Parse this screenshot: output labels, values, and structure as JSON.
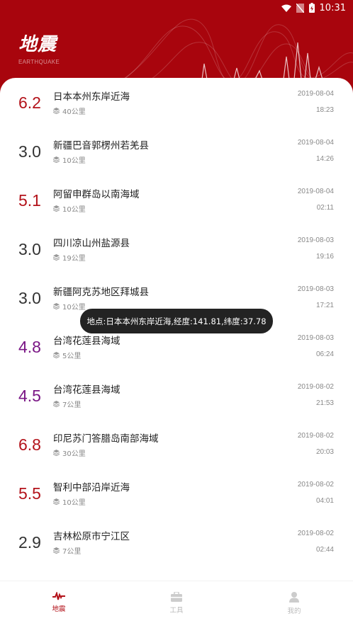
{
  "status_bar": {
    "time": "10:31"
  },
  "header": {
    "title": "地震",
    "subtitle": "EARTHQUAKE"
  },
  "colors": {
    "brand_red": "#a8050d",
    "mag_high": "#b3121a",
    "mag_mid": "#7a1685",
    "mag_low": "#333333"
  },
  "events": [
    {
      "magnitude": "6.2",
      "place": "日本本州东岸近海",
      "depth": "40公里",
      "date": "2019-08-04",
      "time": "18:23",
      "level": "high"
    },
    {
      "magnitude": "3.0",
      "place": "新疆巴音郭楞州若羌县",
      "depth": "10公里",
      "date": "2019-08-04",
      "time": "14:26",
      "level": "low"
    },
    {
      "magnitude": "5.1",
      "place": "阿留申群岛以南海域",
      "depth": "10公里",
      "date": "2019-08-04",
      "time": "02:11",
      "level": "high"
    },
    {
      "magnitude": "3.0",
      "place": "四川凉山州盐源县",
      "depth": "19公里",
      "date": "2019-08-03",
      "time": "19:16",
      "level": "low"
    },
    {
      "magnitude": "3.0",
      "place": "新疆阿克苏地区拜城县",
      "depth": "10公里",
      "date": "2019-08-03",
      "time": "17:21",
      "level": "low"
    },
    {
      "magnitude": "4.8",
      "place": "台湾花莲县海域",
      "depth": "5公里",
      "date": "2019-08-03",
      "time": "06:24",
      "level": "mid"
    },
    {
      "magnitude": "4.5",
      "place": "台湾花莲县海域",
      "depth": "7公里",
      "date": "2019-08-02",
      "time": "21:53",
      "level": "mid"
    },
    {
      "magnitude": "6.8",
      "place": "印尼苏门答腊岛南部海域",
      "depth": "30公里",
      "date": "2019-08-02",
      "time": "20:03",
      "level": "high"
    },
    {
      "magnitude": "5.5",
      "place": "智利中部沿岸近海",
      "depth": "10公里",
      "date": "2019-08-02",
      "time": "04:01",
      "level": "high"
    },
    {
      "magnitude": "2.9",
      "place": "吉林松原市宁江区",
      "depth": "7公里",
      "date": "2019-08-02",
      "time": "02:44",
      "level": "low"
    }
  ],
  "toast": "地点:日本本州东岸近海,经度:141.81,纬度:37.78",
  "tabs": [
    {
      "label": "地震",
      "icon": "pulse-icon",
      "active": true
    },
    {
      "label": "工具",
      "icon": "toolbox-icon",
      "active": false
    },
    {
      "label": "我的",
      "icon": "person-icon",
      "active": false
    }
  ]
}
